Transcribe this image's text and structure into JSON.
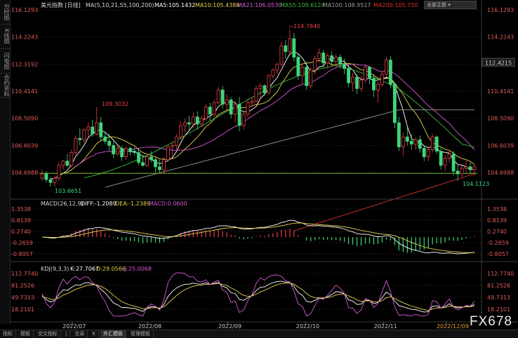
{
  "sidebar": {
    "items": [
      {
        "label": "分时图"
      },
      {
        "label": "K线图"
      },
      {
        "label": "闪电图"
      },
      {
        "label": "合约资料"
      }
    ]
  },
  "header": {
    "symbol": "美元指数 [日线]",
    "ma_label": "MA(5,10,21,55,100,200)",
    "ma5": "MA5:105.1432",
    "ma10": "MA10:105.4388",
    "ma21": "MA21:106.0530",
    "ma55": "MA55:109.6124",
    "ma100": "MA100:108.9517",
    "ma200": "MA200:105.750",
    "dropdown": "全部主题"
  },
  "colors": {
    "up": "#e8414a",
    "down": "#3ed67a",
    "ma5": "#ffffff",
    "ma10": "#e6d34c",
    "ma21": "#d659d6",
    "ma55": "#3dbb3d",
    "ma100": "#9a9a9a",
    "ma200": "#e03030",
    "axis_text": "#e05a5a",
    "grid": "#3a2a2a"
  },
  "price_axis": [
    "116.1293",
    "114.2243",
    "112.3192",
    "110.4141",
    "108.5090",
    "106.6039",
    "104.6988"
  ],
  "current_price": "112.4215",
  "annotations": {
    "high": "114.7840",
    "left_peak": "109.3032",
    "left_low": "103.6651",
    "right_low": "104.1123"
  },
  "macd": {
    "label": "MACD(26,12,9)",
    "diff": "DIFF:-1.2089",
    "dea": "DEA:-1.2389",
    "macd": "MACD:0.0600",
    "axis": [
      "1.3538",
      "0.8139",
      "0.2740",
      "-0.2659",
      "-0.8057"
    ]
  },
  "kdj": {
    "label": "KDJ(9,3,3)",
    "k": "K:27.7067",
    "d": "D:29.0566",
    "j": "J:25.0068",
    "axis": [
      "112.7740",
      "81.2526",
      "49.7313",
      "18.2101"
    ]
  },
  "dates": [
    "2022/07",
    "2022/08",
    "2022/09",
    "2022/10",
    "2022/11",
    "2022/12/09"
  ],
  "bottom_tabs": [
    "指标",
    "模板",
    "交叉指标",
    "|",
    "交易",
    "K",
    "外汇模板",
    "管理模板"
  ],
  "watermark": "FX678",
  "chart_data": {
    "type": "candlestick",
    "title": "美元指数 [日线]",
    "x_labels": [
      "2022/07",
      "2022/08",
      "2022/09",
      "2022/10",
      "2022/11",
      "2022/12/09"
    ],
    "ylim": [
      103.2,
      116.13
    ],
    "candles": [
      [
        104.3,
        104.9,
        104.1,
        104.6
      ],
      [
        104.6,
        104.8,
        104.0,
        104.2
      ],
      [
        104.2,
        104.4,
        103.7,
        104.0
      ],
      [
        104.0,
        104.5,
        103.7,
        104.3
      ],
      [
        104.3,
        105.4,
        104.1,
        105.2
      ],
      [
        105.2,
        105.6,
        104.9,
        105.5
      ],
      [
        105.5,
        106.0,
        105.1,
        105.2
      ],
      [
        105.2,
        106.3,
        105.1,
        106.1
      ],
      [
        106.1,
        107.3,
        105.9,
        107.1
      ],
      [
        107.1,
        107.8,
        106.6,
        107.0
      ],
      [
        107.0,
        107.8,
        106.8,
        107.7
      ],
      [
        107.7,
        108.2,
        107.2,
        107.9
      ],
      [
        107.9,
        108.4,
        107.2,
        107.4
      ],
      [
        107.4,
        109.3,
        107.3,
        108.2
      ],
      [
        108.2,
        108.6,
        106.9,
        107.2
      ],
      [
        107.2,
        107.6,
        106.7,
        106.9
      ],
      [
        106.9,
        107.4,
        106.2,
        106.6
      ],
      [
        106.6,
        106.9,
        105.7,
        106.0
      ],
      [
        106.0,
        106.6,
        105.9,
        106.4
      ],
      [
        106.4,
        106.6,
        105.5,
        105.8
      ],
      [
        105.8,
        106.5,
        105.6,
        106.4
      ],
      [
        106.4,
        106.5,
        105.9,
        106.2
      ],
      [
        106.2,
        106.5,
        105.9,
        106.1
      ],
      [
        106.1,
        106.4,
        105.2,
        105.4
      ],
      [
        105.4,
        105.9,
        105.1,
        105.2
      ],
      [
        105.2,
        106.0,
        105.1,
        105.8
      ],
      [
        105.8,
        106.2,
        105.4,
        105.6
      ],
      [
        105.6,
        105.8,
        104.7,
        105.1
      ],
      [
        105.1,
        105.6,
        104.7,
        104.9
      ],
      [
        104.9,
        105.8,
        104.6,
        105.6
      ],
      [
        105.6,
        106.6,
        105.5,
        106.5
      ],
      [
        106.5,
        106.8,
        105.9,
        106.6
      ],
      [
        106.6,
        107.4,
        106.3,
        107.2
      ],
      [
        107.2,
        108.3,
        107.0,
        108.0
      ],
      [
        108.0,
        108.5,
        107.5,
        108.2
      ],
      [
        108.2,
        108.7,
        107.7,
        108.1
      ],
      [
        108.1,
        108.9,
        107.8,
        108.6
      ],
      [
        108.6,
        109.0,
        107.7,
        108.1
      ],
      [
        108.1,
        108.7,
        107.9,
        108.5
      ],
      [
        108.5,
        109.5,
        108.3,
        109.3
      ],
      [
        109.3,
        109.6,
        108.3,
        108.8
      ],
      [
        108.8,
        109.8,
        108.6,
        109.6
      ],
      [
        109.6,
        110.7,
        109.5,
        110.5
      ],
      [
        110.5,
        110.8,
        109.2,
        109.5
      ],
      [
        109.5,
        110.2,
        109.0,
        109.8
      ],
      [
        109.8,
        110.0,
        108.5,
        108.8
      ],
      [
        108.8,
        109.7,
        108.2,
        109.5
      ],
      [
        109.5,
        110.0,
        107.6,
        108.0
      ],
      [
        108.0,
        109.0,
        107.7,
        108.8
      ],
      [
        108.8,
        109.8,
        108.6,
        109.6
      ],
      [
        109.6,
        110.0,
        109.3,
        109.7
      ],
      [
        109.7,
        110.8,
        109.6,
        110.6
      ],
      [
        110.6,
        111.0,
        109.9,
        110.8
      ],
      [
        110.8,
        110.9,
        110.1,
        110.3
      ],
      [
        110.3,
        111.6,
        110.2,
        111.5
      ],
      [
        111.5,
        112.0,
        111.3,
        111.9
      ],
      [
        111.9,
        112.4,
        111.6,
        112.3
      ],
      [
        112.3,
        113.9,
        112.1,
        113.6
      ],
      [
        113.6,
        114.0,
        112.7,
        113.2
      ],
      [
        113.2,
        114.8,
        112.9,
        114.1
      ],
      [
        114.1,
        114.5,
        112.5,
        112.8
      ],
      [
        112.8,
        113.0,
        111.2,
        111.5
      ],
      [
        111.5,
        112.3,
        110.9,
        112.1
      ],
      [
        112.1,
        112.5,
        110.5,
        110.8
      ],
      [
        110.8,
        112.1,
        110.6,
        111.9
      ],
      [
        111.9,
        112.9,
        111.6,
        112.7
      ],
      [
        112.7,
        113.4,
        112.4,
        113.1
      ],
      [
        113.1,
        113.3,
        112.1,
        112.4
      ],
      [
        112.4,
        113.1,
        112.0,
        112.9
      ],
      [
        112.9,
        113.2,
        112.2,
        112.5
      ],
      [
        112.5,
        113.0,
        112.2,
        112.8
      ],
      [
        112.8,
        113.0,
        112.0,
        112.3
      ],
      [
        112.3,
        112.7,
        111.6,
        112.0
      ],
      [
        112.0,
        112.3,
        110.7,
        111.0
      ],
      [
        111.0,
        111.7,
        110.4,
        111.4
      ],
      [
        111.4,
        111.6,
        110.2,
        110.6
      ],
      [
        110.6,
        111.5,
        110.4,
        111.2
      ],
      [
        111.2,
        112.3,
        111.0,
        112.1
      ],
      [
        112.1,
        112.2,
        110.9,
        111.3
      ],
      [
        111.3,
        111.6,
        110.0,
        110.5
      ],
      [
        110.5,
        111.1,
        109.6,
        110.9
      ],
      [
        110.9,
        111.8,
        110.7,
        111.6
      ],
      [
        111.6,
        112.8,
        111.4,
        112.6
      ],
      [
        112.6,
        112.9,
        110.6,
        110.9
      ],
      [
        110.9,
        111.0,
        107.8,
        108.2
      ],
      [
        108.2,
        108.6,
        106.2,
        106.5
      ],
      [
        106.5,
        107.5,
        105.9,
        107.2
      ],
      [
        107.2,
        107.9,
        106.6,
        106.9
      ],
      [
        106.9,
        107.4,
        106.3,
        106.7
      ],
      [
        106.7,
        107.2,
        106.3,
        107.0
      ],
      [
        107.0,
        107.3,
        106.1,
        106.4
      ],
      [
        106.4,
        106.6,
        105.5,
        105.8
      ],
      [
        105.8,
        106.5,
        105.5,
        106.3
      ],
      [
        106.3,
        107.4,
        106.1,
        107.2
      ],
      [
        107.2,
        107.3,
        106.0,
        106.2
      ],
      [
        106.2,
        106.5,
        104.9,
        105.2
      ],
      [
        105.2,
        105.9,
        104.8,
        105.7
      ],
      [
        105.7,
        106.3,
        105.4,
        106.0
      ],
      [
        106.0,
        106.2,
        104.5,
        104.8
      ],
      [
        104.8,
        105.2,
        104.1,
        104.6
      ],
      [
        104.6,
        105.2,
        104.4,
        105.0
      ],
      [
        105.0,
        105.6,
        104.7,
        105.1
      ],
      [
        105.1,
        105.4,
        104.6,
        104.9
      ],
      [
        104.9,
        105.3,
        104.5,
        105.1
      ]
    ]
  }
}
